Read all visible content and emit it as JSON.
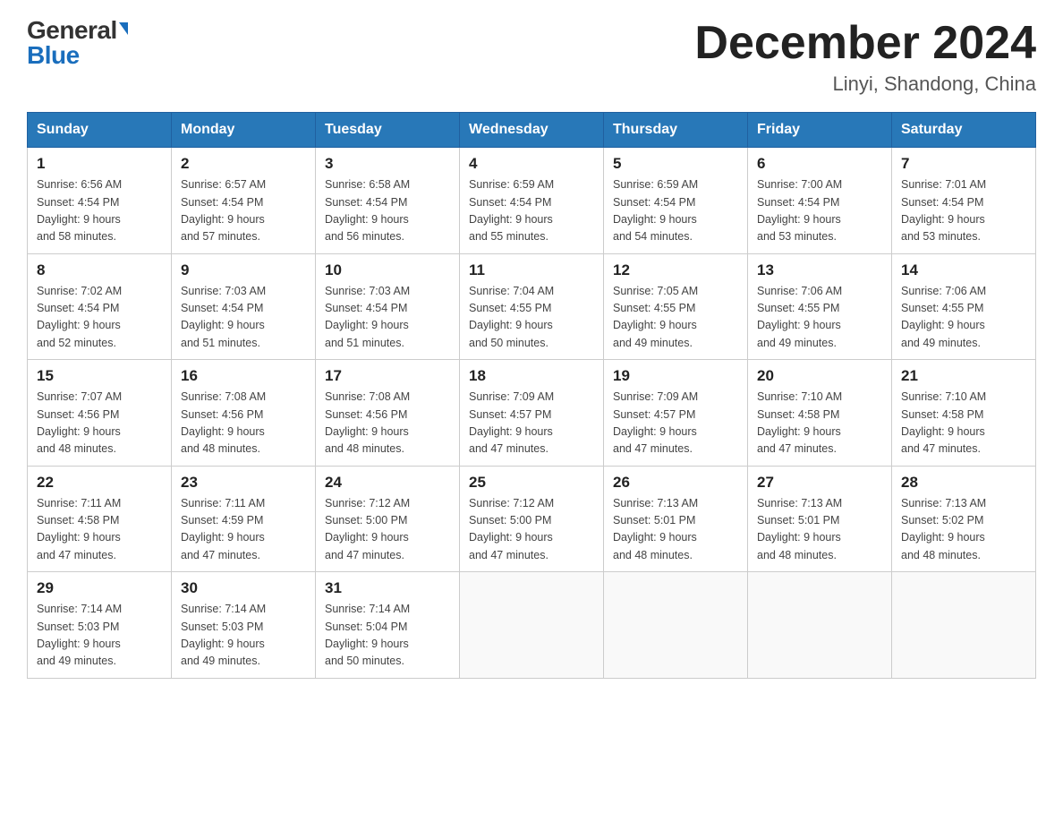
{
  "logo": {
    "general": "General",
    "blue": "Blue"
  },
  "title": "December 2024",
  "subtitle": "Linyi, Shandong, China",
  "days_of_week": [
    "Sunday",
    "Monday",
    "Tuesday",
    "Wednesday",
    "Thursday",
    "Friday",
    "Saturday"
  ],
  "weeks": [
    [
      {
        "day": "1",
        "sunrise": "6:56 AM",
        "sunset": "4:54 PM",
        "daylight": "9 hours and 58 minutes."
      },
      {
        "day": "2",
        "sunrise": "6:57 AM",
        "sunset": "4:54 PM",
        "daylight": "9 hours and 57 minutes."
      },
      {
        "day": "3",
        "sunrise": "6:58 AM",
        "sunset": "4:54 PM",
        "daylight": "9 hours and 56 minutes."
      },
      {
        "day": "4",
        "sunrise": "6:59 AM",
        "sunset": "4:54 PM",
        "daylight": "9 hours and 55 minutes."
      },
      {
        "day": "5",
        "sunrise": "6:59 AM",
        "sunset": "4:54 PM",
        "daylight": "9 hours and 54 minutes."
      },
      {
        "day": "6",
        "sunrise": "7:00 AM",
        "sunset": "4:54 PM",
        "daylight": "9 hours and 53 minutes."
      },
      {
        "day": "7",
        "sunrise": "7:01 AM",
        "sunset": "4:54 PM",
        "daylight": "9 hours and 53 minutes."
      }
    ],
    [
      {
        "day": "8",
        "sunrise": "7:02 AM",
        "sunset": "4:54 PM",
        "daylight": "9 hours and 52 minutes."
      },
      {
        "day": "9",
        "sunrise": "7:03 AM",
        "sunset": "4:54 PM",
        "daylight": "9 hours and 51 minutes."
      },
      {
        "day": "10",
        "sunrise": "7:03 AM",
        "sunset": "4:54 PM",
        "daylight": "9 hours and 51 minutes."
      },
      {
        "day": "11",
        "sunrise": "7:04 AM",
        "sunset": "4:55 PM",
        "daylight": "9 hours and 50 minutes."
      },
      {
        "day": "12",
        "sunrise": "7:05 AM",
        "sunset": "4:55 PM",
        "daylight": "9 hours and 49 minutes."
      },
      {
        "day": "13",
        "sunrise": "7:06 AM",
        "sunset": "4:55 PM",
        "daylight": "9 hours and 49 minutes."
      },
      {
        "day": "14",
        "sunrise": "7:06 AM",
        "sunset": "4:55 PM",
        "daylight": "9 hours and 49 minutes."
      }
    ],
    [
      {
        "day": "15",
        "sunrise": "7:07 AM",
        "sunset": "4:56 PM",
        "daylight": "9 hours and 48 minutes."
      },
      {
        "day": "16",
        "sunrise": "7:08 AM",
        "sunset": "4:56 PM",
        "daylight": "9 hours and 48 minutes."
      },
      {
        "day": "17",
        "sunrise": "7:08 AM",
        "sunset": "4:56 PM",
        "daylight": "9 hours and 48 minutes."
      },
      {
        "day": "18",
        "sunrise": "7:09 AM",
        "sunset": "4:57 PM",
        "daylight": "9 hours and 47 minutes."
      },
      {
        "day": "19",
        "sunrise": "7:09 AM",
        "sunset": "4:57 PM",
        "daylight": "9 hours and 47 minutes."
      },
      {
        "day": "20",
        "sunrise": "7:10 AM",
        "sunset": "4:58 PM",
        "daylight": "9 hours and 47 minutes."
      },
      {
        "day": "21",
        "sunrise": "7:10 AM",
        "sunset": "4:58 PM",
        "daylight": "9 hours and 47 minutes."
      }
    ],
    [
      {
        "day": "22",
        "sunrise": "7:11 AM",
        "sunset": "4:58 PM",
        "daylight": "9 hours and 47 minutes."
      },
      {
        "day": "23",
        "sunrise": "7:11 AM",
        "sunset": "4:59 PM",
        "daylight": "9 hours and 47 minutes."
      },
      {
        "day": "24",
        "sunrise": "7:12 AM",
        "sunset": "5:00 PM",
        "daylight": "9 hours and 47 minutes."
      },
      {
        "day": "25",
        "sunrise": "7:12 AM",
        "sunset": "5:00 PM",
        "daylight": "9 hours and 47 minutes."
      },
      {
        "day": "26",
        "sunrise": "7:13 AM",
        "sunset": "5:01 PM",
        "daylight": "9 hours and 48 minutes."
      },
      {
        "day": "27",
        "sunrise": "7:13 AM",
        "sunset": "5:01 PM",
        "daylight": "9 hours and 48 minutes."
      },
      {
        "day": "28",
        "sunrise": "7:13 AM",
        "sunset": "5:02 PM",
        "daylight": "9 hours and 48 minutes."
      }
    ],
    [
      {
        "day": "29",
        "sunrise": "7:14 AM",
        "sunset": "5:03 PM",
        "daylight": "9 hours and 49 minutes."
      },
      {
        "day": "30",
        "sunrise": "7:14 AM",
        "sunset": "5:03 PM",
        "daylight": "9 hours and 49 minutes."
      },
      {
        "day": "31",
        "sunrise": "7:14 AM",
        "sunset": "5:04 PM",
        "daylight": "9 hours and 50 minutes."
      },
      null,
      null,
      null,
      null
    ]
  ],
  "labels": {
    "sunrise": "Sunrise:",
    "sunset": "Sunset:",
    "daylight": "Daylight:"
  }
}
